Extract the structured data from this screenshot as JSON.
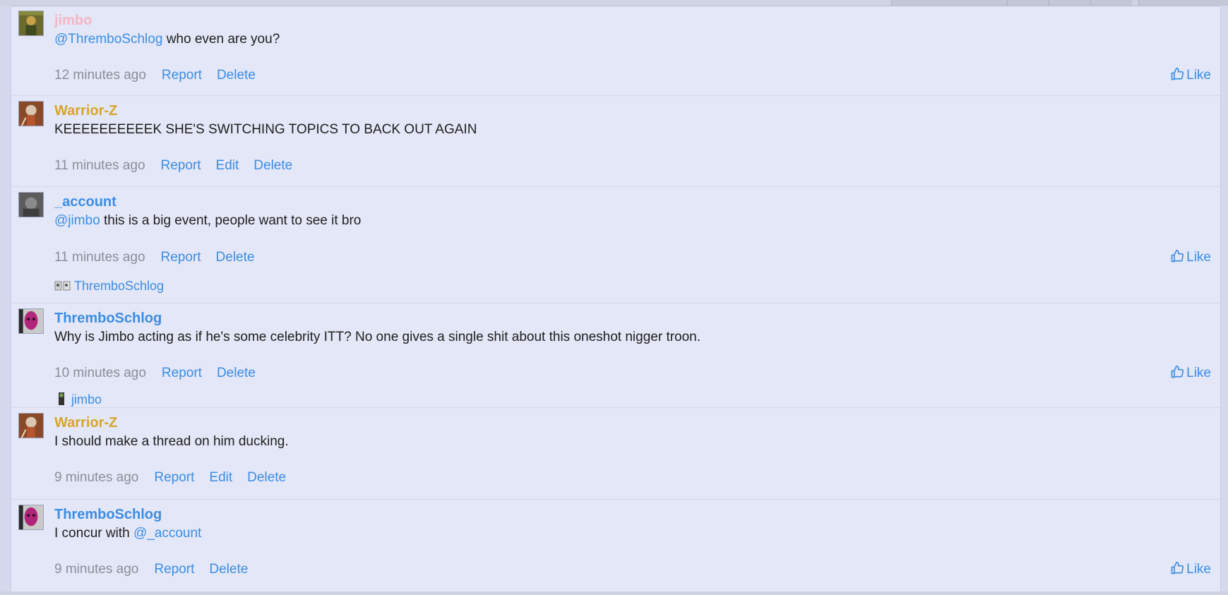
{
  "posts": [
    {
      "author": "jimbo",
      "mention": "@ThremboSchlog",
      "text": " who even are you?",
      "time": "12 minutes ago",
      "actions": [
        "Report",
        "Delete"
      ],
      "like": "Like"
    },
    {
      "author": "Warrior-Z",
      "text": "KEEEEEEEEEEK SHE'S SWITCHING TOPICS TO BACK OUT AGAIN",
      "time": "11 minutes ago",
      "actions": [
        "Report",
        "Edit",
        "Delete"
      ]
    },
    {
      "author": "_account",
      "mention": "@jimbo",
      "text": " this is a big event, people want to see it bro",
      "time": "11 minutes ago",
      "actions": [
        "Report",
        "Delete"
      ],
      "like": "Like",
      "liked_by": "ThremboSchlog"
    },
    {
      "author": "ThremboSchlog",
      "text": "Why is Jimbo acting as if he's some celebrity ITT? No one gives a single shit about this oneshot nigger troon.",
      "time": "10 minutes ago",
      "actions": [
        "Report",
        "Delete"
      ],
      "like": "Like",
      "liked_by": "jimbo"
    },
    {
      "author": "Warrior-Z",
      "text": "I should make a thread on him ducking.",
      "time": "9 minutes ago",
      "actions": [
        "Report",
        "Edit",
        "Delete"
      ]
    },
    {
      "author": "ThremboSchlog",
      "text": "I concur with ",
      "mention_after": "@_account",
      "time": "9 minutes ago",
      "actions": [
        "Report",
        "Delete"
      ],
      "like": "Like"
    }
  ],
  "colors": {
    "background": "#e4e7f7",
    "link": "#3b8de4",
    "muted": "#8a8e99",
    "author_pink": "#f4b6c4",
    "author_gold": "#d6a52a",
    "author_blue": "#3b8de4"
  }
}
